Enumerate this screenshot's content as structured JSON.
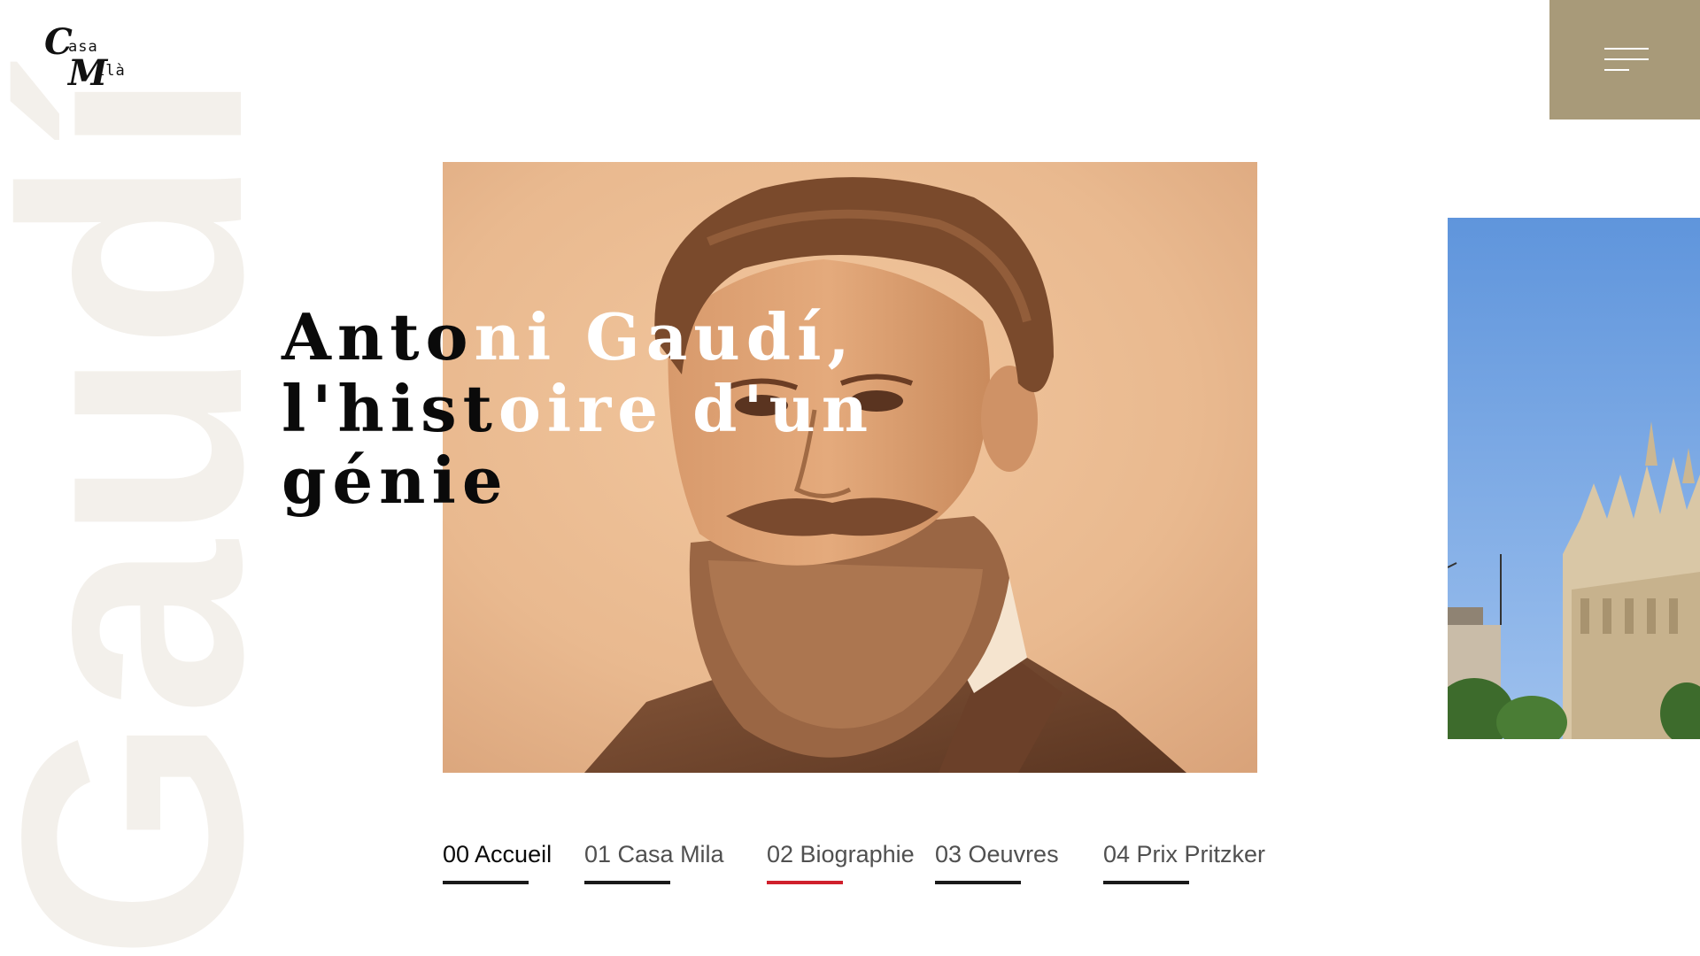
{
  "logo": {
    "big_c": "C",
    "asa": "asa",
    "big_m": "M",
    "ila": "ilà"
  },
  "watermark": {
    "text": "Gaudí",
    "color": "#f3f0eb"
  },
  "hero": {
    "title_lines": [
      {
        "dark": "Anto",
        "light": "ni Gaudí,"
      },
      {
        "dark": "l'hist",
        "light": "oire d'un"
      },
      {
        "dark": "génie",
        "light": ""
      }
    ]
  },
  "menu": {
    "color": "#a89a79",
    "icon": "hamburger-menu-icon"
  },
  "tabs": [
    {
      "label": "00 Accueil",
      "state": "active"
    },
    {
      "label": "01 Casa Mila",
      "state": ""
    },
    {
      "label": "02 Biographie",
      "state": "current"
    },
    {
      "label": "03 Oeuvres",
      "state": ""
    },
    {
      "label": "04 Prix Pritzker",
      "state": ""
    }
  ],
  "colors": {
    "accent_red": "#d0202c",
    "tab_bar": "#1a1a1a",
    "sepia": "#e9b98f"
  }
}
